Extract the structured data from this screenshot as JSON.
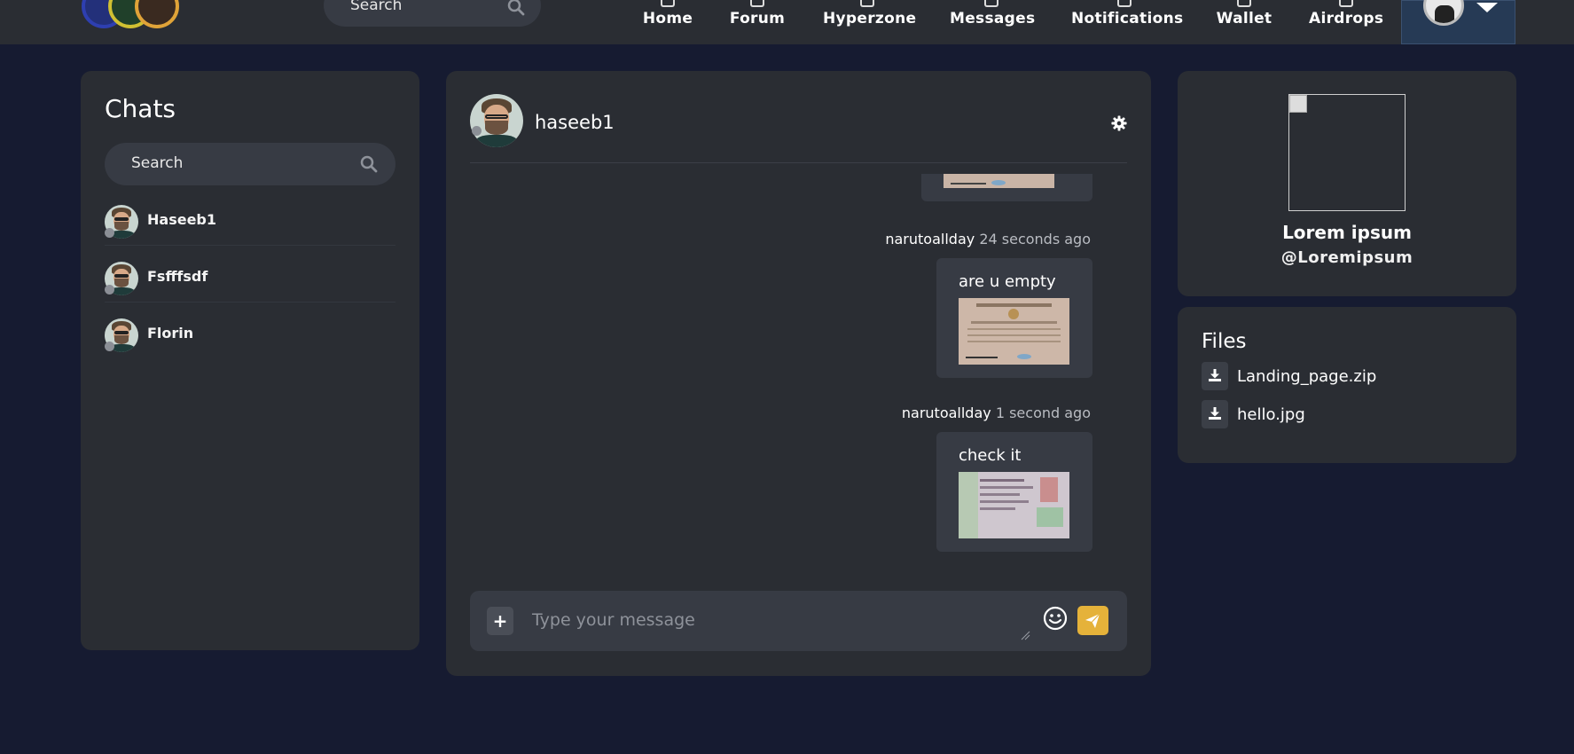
{
  "nav": {
    "search_placeholder": "Search",
    "items": [
      {
        "label": "Home",
        "icon": "home-icon"
      },
      {
        "label": "Forum",
        "icon": "forum-icon"
      },
      {
        "label": "Hyperzone",
        "icon": "hyperzone-icon"
      },
      {
        "label": "Messages",
        "icon": "messages-icon"
      },
      {
        "label": "Notifications",
        "icon": "bell-icon"
      },
      {
        "label": "Wallet",
        "icon": "wallet-icon"
      },
      {
        "label": "Airdrops",
        "icon": "airdrop-icon"
      }
    ]
  },
  "chats": {
    "title": "Chats",
    "search_placeholder": "Search",
    "list": [
      {
        "name": "Haseeb1"
      },
      {
        "name": "Fsfffsdf"
      },
      {
        "name": "Florin"
      }
    ]
  },
  "conversation": {
    "contact_name": "haseeb1",
    "messages": [
      {
        "user": "narutoallday",
        "time": "24 seconds ago",
        "text": "are u empty"
      },
      {
        "user": "narutoallday",
        "time": "1 second ago",
        "text": "check it"
      }
    ],
    "composer": {
      "placeholder": "Type your message",
      "add_button": "+"
    }
  },
  "profile": {
    "name": "Lorem ipsum",
    "handle": "@Loremipsum"
  },
  "files": {
    "title": "Files",
    "list": [
      {
        "name": "Landing_page.zip"
      },
      {
        "name": "hello.jpg"
      }
    ]
  },
  "colors": {
    "background": "#161b31",
    "panel": "#2a2d33",
    "input": "#373b44",
    "accent": "#e5b23a"
  }
}
